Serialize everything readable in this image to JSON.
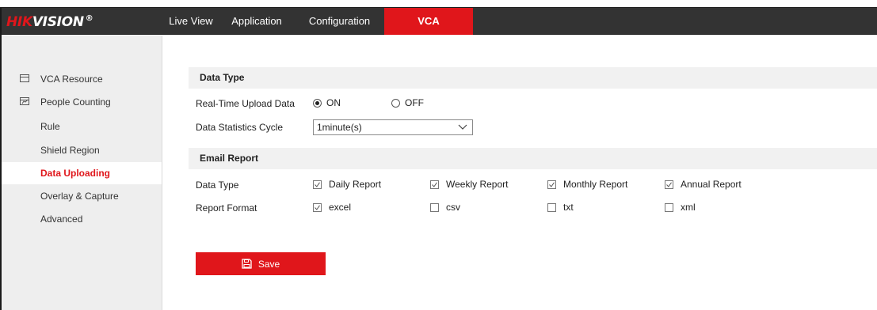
{
  "brand": {
    "logo_red": "HIK",
    "logo_white": "VISION",
    "logo_reg": "®",
    "accent": "#e0161b"
  },
  "nav": {
    "items": [
      {
        "label": "Live View",
        "active": false
      },
      {
        "label": "Application",
        "active": false
      },
      {
        "label": "Configuration",
        "active": false
      },
      {
        "label": "VCA",
        "active": true
      }
    ]
  },
  "sidebar": {
    "groups": [
      {
        "label": "VCA Resource",
        "icon": "monitor-icon"
      },
      {
        "label": "People Counting",
        "icon": "chart-icon"
      }
    ],
    "items": [
      {
        "label": "Rule",
        "active": false
      },
      {
        "label": "Shield Region",
        "active": false
      },
      {
        "label": "Data Uploading",
        "active": true
      },
      {
        "label": "Overlay & Capture",
        "active": false
      },
      {
        "label": "Advanced",
        "active": false
      }
    ]
  },
  "data_type_section": {
    "title": "Data Type",
    "realtime_label": "Real-Time Upload Data",
    "realtime_on": "ON",
    "realtime_off": "OFF",
    "realtime_value": "ON",
    "cycle_label": "Data Statistics Cycle",
    "cycle_value": "1minute(s)"
  },
  "email_section": {
    "title": "Email Report",
    "type_label": "Data Type",
    "types": [
      {
        "label": "Daily Report",
        "checked": true
      },
      {
        "label": "Weekly Report",
        "checked": true
      },
      {
        "label": "Monthly Report",
        "checked": true
      },
      {
        "label": "Annual Report",
        "checked": true
      }
    ],
    "format_label": "Report Format",
    "formats": [
      {
        "label": "excel",
        "checked": true
      },
      {
        "label": "csv",
        "checked": false
      },
      {
        "label": "txt",
        "checked": false
      },
      {
        "label": "xml",
        "checked": false
      }
    ]
  },
  "actions": {
    "save_label": "Save"
  }
}
